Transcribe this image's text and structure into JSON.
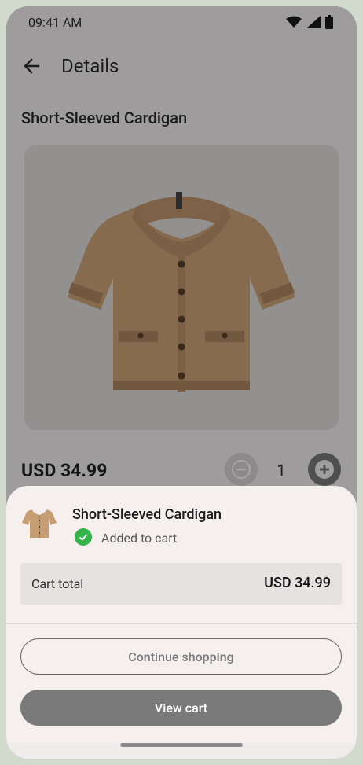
{
  "status_bar": {
    "time": "09:41 AM"
  },
  "app_bar": {
    "title": "Details"
  },
  "product": {
    "title": "Short-Sleeved Cardigan",
    "price": "USD 34.99",
    "quantity": "1"
  },
  "sheet": {
    "item_name": "Short-Sleeved Cardigan",
    "status_text": "Added to cart",
    "cart_total_label": "Cart total",
    "cart_total_value": "USD 34.99",
    "continue_label": "Continue shopping",
    "view_cart_label": "View cart"
  },
  "icons": {
    "back": "arrow-back-icon",
    "wifi": "wifi-icon",
    "signal": "cellular-signal-icon",
    "battery": "battery-icon",
    "minus": "minus-circle-icon",
    "plus": "plus-circle-icon",
    "check": "check-circle-icon"
  },
  "colors": {
    "success": "#33b54a",
    "sheet_bg": "#f5efee",
    "scrim": "#9e9c9c"
  }
}
